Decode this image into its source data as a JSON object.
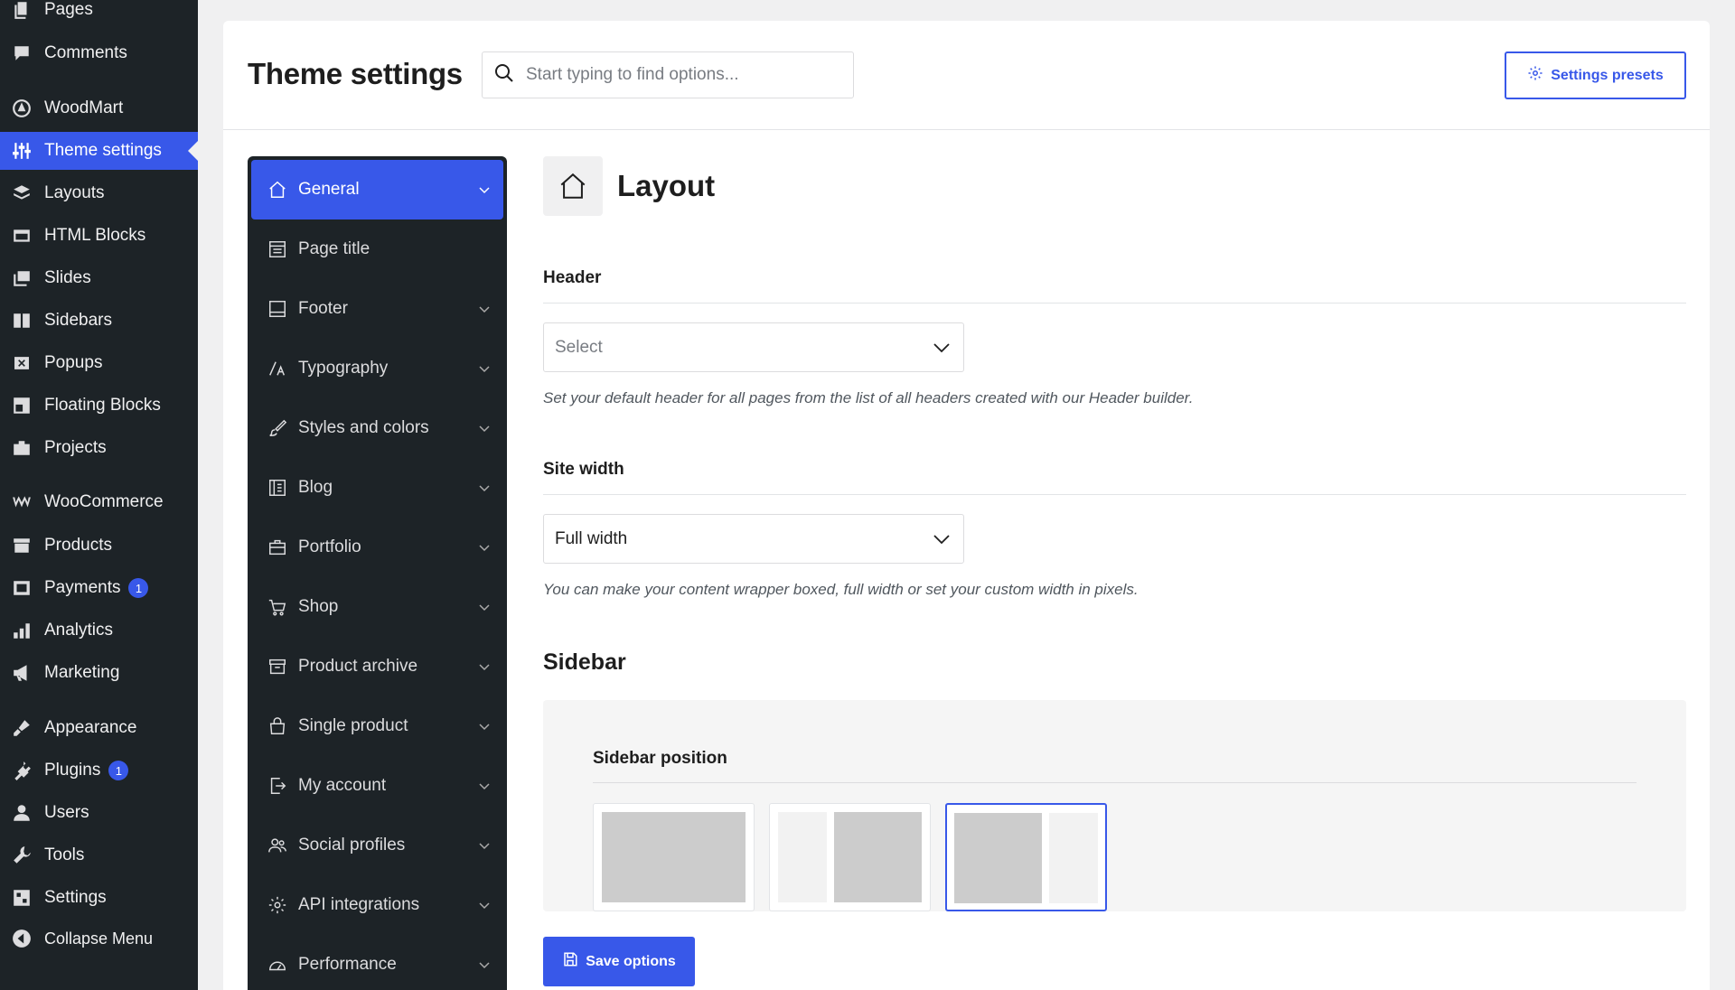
{
  "wp_menu": [
    {
      "label": "Pages",
      "icon": "pages-icon"
    },
    {
      "label": "Comments",
      "icon": "comments-icon"
    },
    {
      "label": "WoodMart",
      "icon": "woodmart-icon"
    },
    {
      "label": "Theme settings",
      "icon": "sliders-icon",
      "active": true
    },
    {
      "label": "Layouts",
      "icon": "layers-icon"
    },
    {
      "label": "HTML Blocks",
      "icon": "code-block-icon"
    },
    {
      "label": "Slides",
      "icon": "slides-icon"
    },
    {
      "label": "Sidebars",
      "icon": "sidebar-icon"
    },
    {
      "label": "Popups",
      "icon": "popup-icon"
    },
    {
      "label": "Floating Blocks",
      "icon": "floating-blocks-icon"
    },
    {
      "label": "Projects",
      "icon": "briefcase-icon"
    },
    {
      "label": "WooCommerce",
      "icon": "woocommerce-icon"
    },
    {
      "label": "Products",
      "icon": "archive-icon"
    },
    {
      "label": "Payments",
      "icon": "payments-icon",
      "badge": "1"
    },
    {
      "label": "Analytics",
      "icon": "bar-chart-icon"
    },
    {
      "label": "Marketing",
      "icon": "megaphone-icon"
    },
    {
      "label": "Appearance",
      "icon": "paintbrush-icon"
    },
    {
      "label": "Plugins",
      "icon": "plug-icon",
      "badge": "1"
    },
    {
      "label": "Users",
      "icon": "user-icon"
    },
    {
      "label": "Tools",
      "icon": "wrench-icon"
    },
    {
      "label": "Settings",
      "icon": "settings-icon"
    },
    {
      "label": "Collapse Menu",
      "icon": "collapse-icon"
    }
  ],
  "header": {
    "title": "Theme settings",
    "search_placeholder": "Start typing to find options...",
    "presets_label": "Settings presets"
  },
  "options_nav": [
    {
      "label": "General",
      "icon": "home-icon",
      "active": true,
      "has_children": true
    },
    {
      "label": "Page title",
      "icon": "page-title-icon",
      "has_children": false
    },
    {
      "label": "Footer",
      "icon": "footer-icon",
      "has_children": true
    },
    {
      "label": "Typography",
      "icon": "typography-icon",
      "has_children": true
    },
    {
      "label": "Styles and colors",
      "icon": "brush-icon",
      "has_children": true
    },
    {
      "label": "Blog",
      "icon": "blog-icon",
      "has_children": true
    },
    {
      "label": "Portfolio",
      "icon": "portfolio-icon",
      "has_children": true
    },
    {
      "label": "Shop",
      "icon": "cart-icon",
      "has_children": true
    },
    {
      "label": "Product archive",
      "icon": "product-archive-icon",
      "has_children": true
    },
    {
      "label": "Single product",
      "icon": "bag-icon",
      "has_children": true
    },
    {
      "label": "My account",
      "icon": "account-icon",
      "has_children": true
    },
    {
      "label": "Social profiles",
      "icon": "social-icon",
      "has_children": true
    },
    {
      "label": "API integrations",
      "icon": "gear-icon",
      "has_children": true
    },
    {
      "label": "Performance",
      "icon": "gauge-icon",
      "has_children": true
    }
  ],
  "section": {
    "title": "Layout",
    "icon": "home-icon",
    "header_field": {
      "label": "Header",
      "value": "Select",
      "help": "Set your default header for all pages from the list of all headers created with our Header builder."
    },
    "site_width_field": {
      "label": "Site width",
      "value": "Full width",
      "help": "You can make your content wrapper boxed, full width or set your custom width in pixels."
    },
    "sidebar_heading": "Sidebar",
    "sidebar_position": {
      "label": "Sidebar position",
      "options": [
        "without",
        "left",
        "right"
      ],
      "selected": "right"
    },
    "save_label": "Save options"
  },
  "colors": {
    "accent": "#3858e9",
    "admin_bg": "#1d2327",
    "page_bg": "#f0f0f1"
  }
}
